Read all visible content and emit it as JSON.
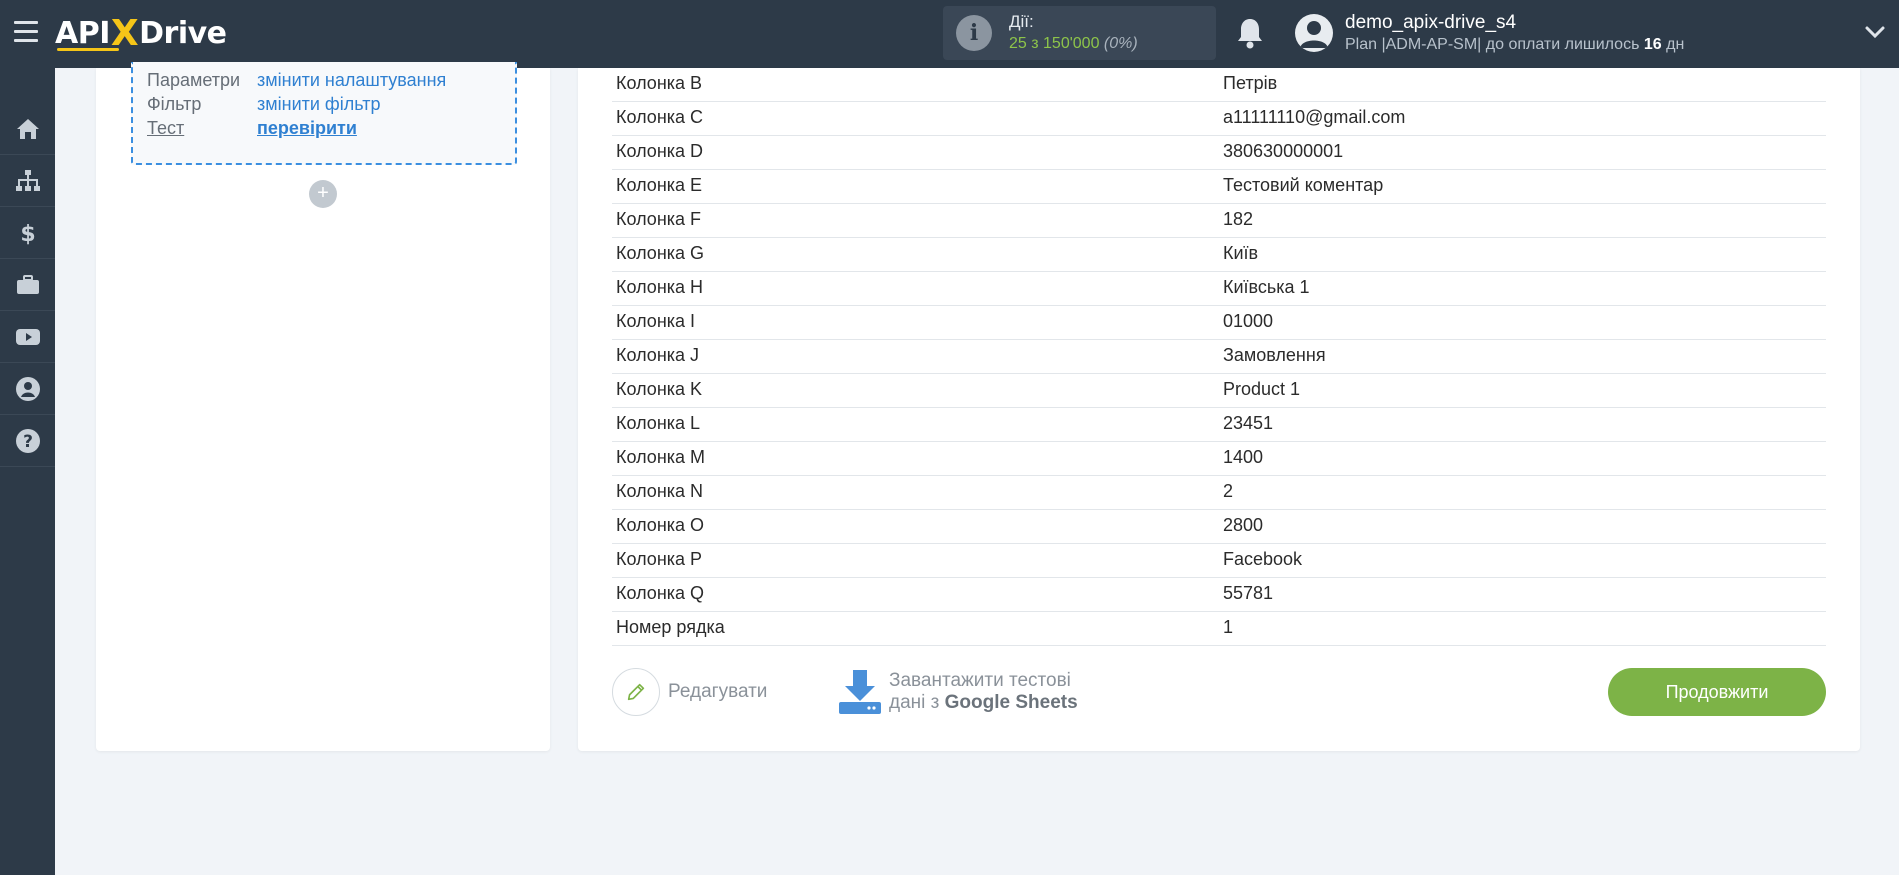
{
  "header": {
    "logo": {
      "pre": "API",
      "x": "X",
      "post": "Drive"
    },
    "actions": {
      "label": "Дії:",
      "value": "25 з 150'000",
      "percent": "(0%)"
    },
    "user": {
      "name": "demo_apix-drive_s4",
      "plan_prefix": "Plan |ADM-AP-SM| до оплати лишилось ",
      "plan_days": "16",
      "plan_suffix": " дн"
    }
  },
  "sidebar": {
    "items": [
      {
        "icon": "home-icon"
      },
      {
        "icon": "sitemap-icon"
      },
      {
        "icon": "dollar-icon"
      },
      {
        "icon": "briefcase-icon"
      },
      {
        "icon": "youtube-icon"
      },
      {
        "icon": "user-icon"
      },
      {
        "icon": "help-icon"
      }
    ]
  },
  "step_box": {
    "rows": [
      {
        "key": "Параметри",
        "value": "змінити налаштування"
      },
      {
        "key": "Фільтр",
        "value": "змінити фільтр"
      },
      {
        "key": "Тест",
        "value": "перевірити"
      }
    ],
    "add_symbol": "+"
  },
  "table": {
    "rows": [
      {
        "column": "Колонка B",
        "value": "Петрів"
      },
      {
        "column": "Колонка C",
        "value": "a11111110@gmail.com"
      },
      {
        "column": "Колонка D",
        "value": "380630000001"
      },
      {
        "column": "Колонка E",
        "value": "Тестовий коментар"
      },
      {
        "column": "Колонка F",
        "value": "182"
      },
      {
        "column": "Колонка G",
        "value": "Київ"
      },
      {
        "column": "Колонка H",
        "value": "Київська 1"
      },
      {
        "column": "Колонка I",
        "value": "01000"
      },
      {
        "column": "Колонка J",
        "value": "Замовлення"
      },
      {
        "column": "Колонка K",
        "value": "Product 1"
      },
      {
        "column": "Колонка L",
        "value": "23451"
      },
      {
        "column": "Колонка M",
        "value": "1400"
      },
      {
        "column": "Колонка N",
        "value": "2"
      },
      {
        "column": "Колонка O",
        "value": "2800"
      },
      {
        "column": "Колонка P",
        "value": "Facebook"
      },
      {
        "column": "Колонка Q",
        "value": "55781"
      },
      {
        "column": "Номер рядка",
        "value": "1"
      }
    ]
  },
  "buttons": {
    "edit": "Редагувати",
    "download_line1": "Завантажити тестові",
    "download_line2_prefix": "дані з ",
    "download_line2_bold": "Google Sheets",
    "continue": "Продовжити"
  },
  "colors": {
    "topbar": "#2d3a48",
    "accent_green": "#7db347",
    "link_blue": "#2f80d1",
    "logo_yellow": "#f5c518"
  }
}
